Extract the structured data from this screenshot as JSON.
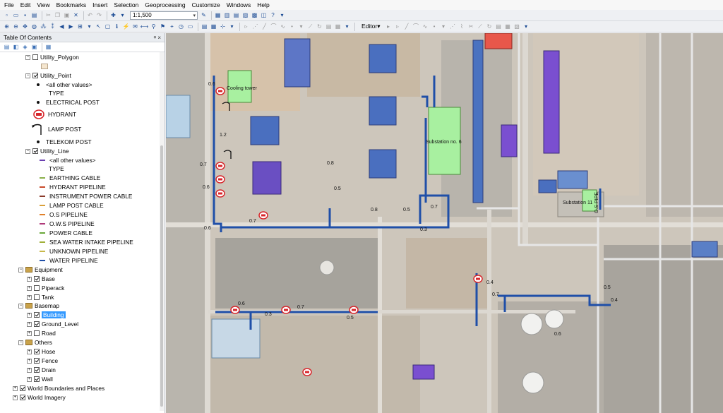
{
  "menu": [
    "File",
    "Edit",
    "View",
    "Bookmarks",
    "Insert",
    "Selection",
    "Geoprocessing",
    "Customize",
    "Windows",
    "Help"
  ],
  "toolbar": {
    "scale": "1:1,500",
    "editor_label": "Editor▾"
  },
  "toc": {
    "title": "Table Of Contents",
    "pin_glyph": "ᵠ ×",
    "items": {
      "utility_polygon": "Utility_Polygon",
      "utility_point": "Utility_Point",
      "pt_other": "<all other values>",
      "pt_type": "TYPE",
      "pt_electrical": "ELECTRICAL POST",
      "pt_hydrant": "HYDRANT",
      "pt_lamp": "LAMP POST",
      "pt_telekom": "TELEKOM POST",
      "utility_line": "Utility_Line",
      "ln_other": "<all other values>",
      "ln_type": "TYPE",
      "ln_earthing": "EARTHING CABLE",
      "ln_hydrant": "HYDRANT PIPELINE",
      "ln_instrument": "INSTRUMENT POWER CABLE",
      "ln_lamp": "LAMP POST CABLE",
      "ln_os": "O.S PIPELINE",
      "ln_ows": "O.W.S PIPELINE",
      "ln_power": "POWER CABLE",
      "ln_sea": "SEA WATER INTAKE PIPELINE",
      "ln_unknown": "UNKNOWN PIPELINE",
      "ln_water": "WATER PIPELINE",
      "equipment": "Equipment",
      "base": "Base",
      "piperack": "Piperack",
      "tank": "Tank",
      "basemap": "Basemap",
      "building": "Building",
      "ground_level": "Ground_Level",
      "road": "Road",
      "others": "Others",
      "hose": "Hose",
      "fence": "Fence",
      "drain": "Drain",
      "wall": "Wall",
      "world_boundaries": "World Boundaries and Places",
      "world_imagery": "World Imagery"
    }
  },
  "map": {
    "labels": {
      "cooling_tower": "Cooling tower",
      "substation_6": "Substation no. 6",
      "substation_11": "Substation 11",
      "os_pipe": "O.S PIPE"
    },
    "dims": [
      "0.6",
      "1.2",
      "0.7",
      "0.6",
      "0.8",
      "0.5",
      "0.7",
      "0.6",
      "0.8",
      "0.5",
      "0.7",
      "0.3",
      "0.6",
      "0.3",
      "0.7",
      "0.5",
      "0.4",
      "0.7",
      "0.5",
      "0.4",
      "0.6"
    ]
  },
  "colors": {
    "pipeline": "#1f4fa8",
    "hydrant": "#d8262b",
    "roof_blue": "#4a6fbf",
    "roof_purple": "#6a4fc2",
    "substation": "#a8f0a0"
  }
}
